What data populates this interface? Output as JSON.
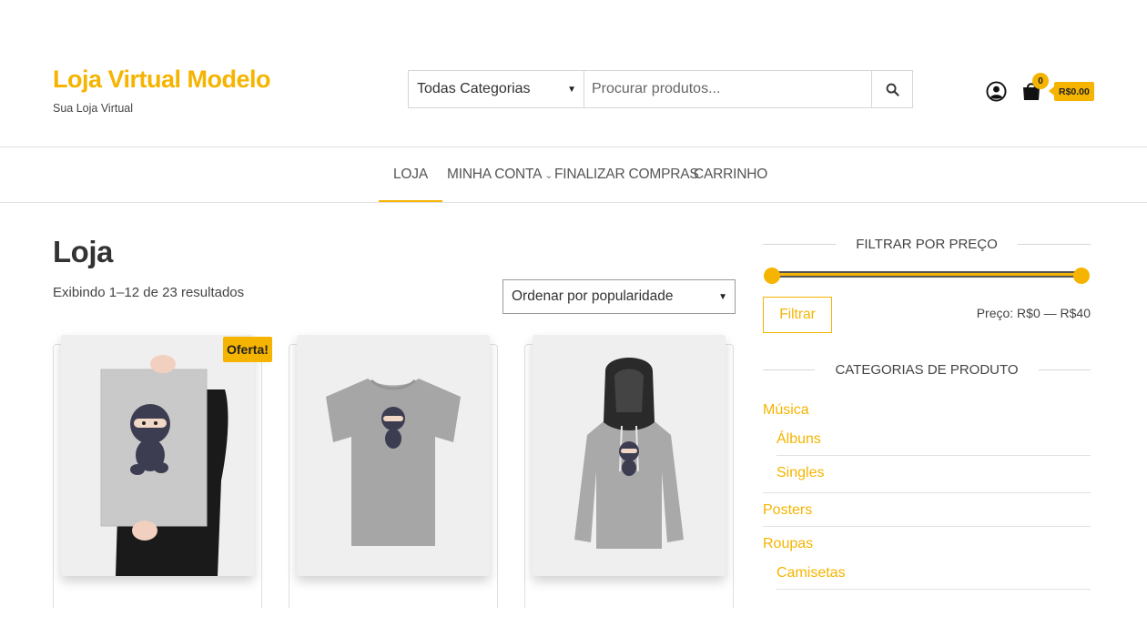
{
  "header": {
    "site_title": "Loja Virtual Modelo",
    "tagline": "Sua Loja Virtual",
    "search": {
      "category": "Todas Categorias",
      "placeholder": "Procurar produtos..."
    },
    "cart": {
      "count": "0",
      "total": "R$0.00"
    }
  },
  "nav": {
    "items": [
      {
        "label": "LOJA"
      },
      {
        "label": "MINHA CONTA"
      },
      {
        "label": "FINALIZAR COMPRAS"
      },
      {
        "label": "CARRINHO"
      }
    ]
  },
  "main": {
    "title": "Loja",
    "result_count": "Exibindo 1–12 de 23 resultados",
    "ordering": "Ordenar por popularidade",
    "sale_badge": "Oferta!"
  },
  "sidebar": {
    "price_filter": {
      "title": "FILTRAR POR PREÇO",
      "button": "Filtrar",
      "price_range": "Preço: R$0 — R$40"
    },
    "categories": {
      "title": "CATEGORIAS DE PRODUTO",
      "items": [
        {
          "label": "Música"
        },
        {
          "label": "Álbuns"
        },
        {
          "label": "Singles"
        },
        {
          "label": "Posters"
        },
        {
          "label": "Roupas"
        },
        {
          "label": "Camisetas"
        }
      ]
    }
  },
  "colors": {
    "accent": "#f5b400",
    "text": "#333333"
  }
}
